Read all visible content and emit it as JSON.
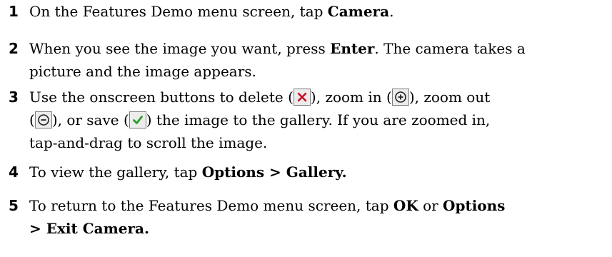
{
  "steps": [
    {
      "num": "1",
      "parts": [
        "On the Features Demo menu screen, tap ",
        "Camera",
        "."
      ]
    },
    {
      "num": "2",
      "line1": [
        "When you see the image you want, press ",
        "Enter",
        ". The camera takes a"
      ],
      "line2": "picture and the image appears."
    },
    {
      "num": "3",
      "line1": [
        "Use the onscreen buttons to delete (",
        "), zoom in (",
        "), zoom out"
      ],
      "line2": [
        "(",
        "), or save (",
        ") the image to the gallery. If you are zoomed in,"
      ],
      "line3": "tap-and-drag to scroll the image."
    },
    {
      "num": "4",
      "parts": [
        "To view the gallery, tap ",
        "Options > Gallery."
      ]
    },
    {
      "num": "5",
      "line1": [
        "To return to the Features Demo menu screen, tap ",
        "OK",
        " or ",
        "Options"
      ],
      "line2": "> Exit Camera."
    }
  ],
  "icons": {
    "delete": "delete-icon",
    "zoom_in": "zoom-in-icon",
    "zoom_out": "zoom-out-icon",
    "save": "save-checkmark-icon"
  },
  "colors": {
    "delete_x": "#d0021b",
    "save_check": "#2e9d2e"
  }
}
